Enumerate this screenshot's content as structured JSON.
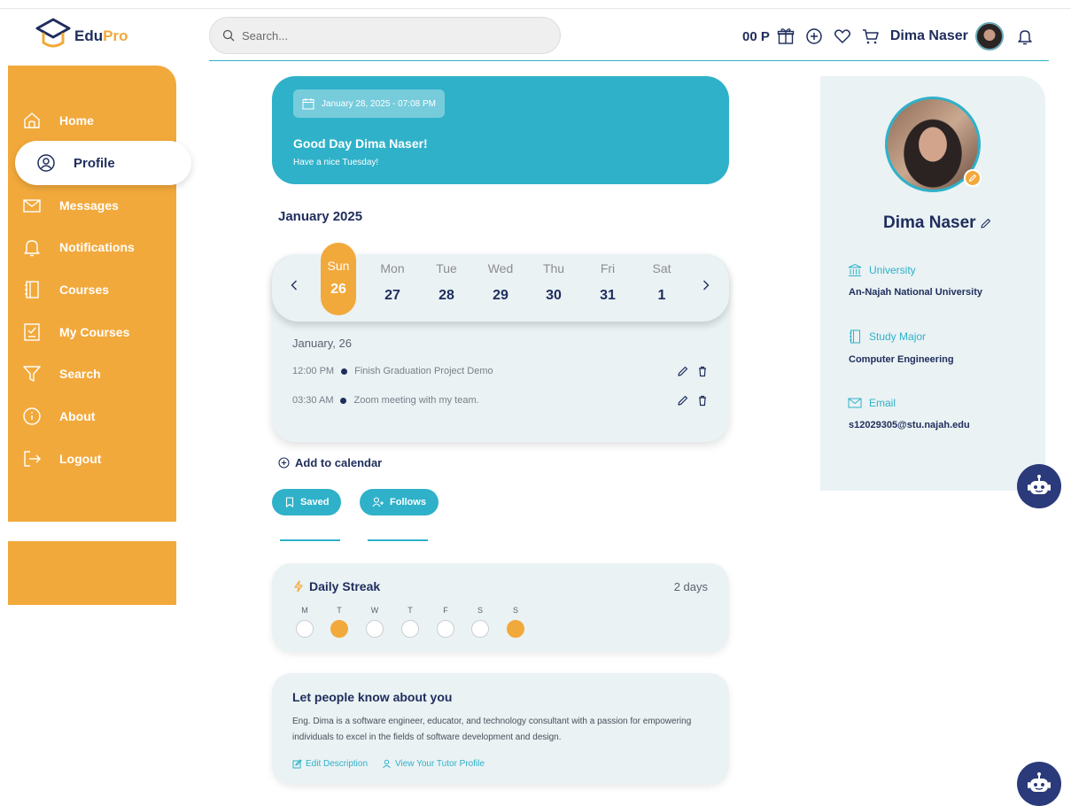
{
  "app": {
    "logo_main": "Edu",
    "logo_accent": "Pro"
  },
  "header": {
    "search_placeholder": "Search...",
    "points": "00 P",
    "user_name": "Dima Naser"
  },
  "sidebar": {
    "items": [
      {
        "label": "Home",
        "icon": "home-icon"
      },
      {
        "label": "Profile",
        "icon": "user-icon",
        "active": true
      },
      {
        "label": "Messages",
        "icon": "mail-icon"
      },
      {
        "label": "Notifications",
        "icon": "bell-icon"
      },
      {
        "label": "Courses",
        "icon": "notebook-icon"
      },
      {
        "label": "My Courses",
        "icon": "checklist-icon"
      },
      {
        "label": "Search",
        "icon": "filter-icon"
      },
      {
        "label": "About",
        "icon": "info-icon"
      },
      {
        "label": "Logout",
        "icon": "logout-icon"
      }
    ]
  },
  "banner": {
    "datetime": "January 28, 2025 - 07:08 PM",
    "greeting": "Good Day Dima Naser!",
    "subtitle": "Have a nice Tuesday!"
  },
  "calendar": {
    "month": "January 2025",
    "days": [
      {
        "name": "Sun",
        "num": "26",
        "selected": true
      },
      {
        "name": "Mon",
        "num": "27"
      },
      {
        "name": "Tue",
        "num": "28"
      },
      {
        "name": "Wed",
        "num": "29"
      },
      {
        "name": "Thu",
        "num": "30"
      },
      {
        "name": "Fri",
        "num": "31"
      },
      {
        "name": "Sat",
        "num": "1"
      }
    ],
    "selected_date_label": "January, 26",
    "events": [
      {
        "time": "12:00 PM",
        "title": "Finish Graduation Project Demo"
      },
      {
        "time": "03:30 AM",
        "title": "Zoom meeting with my team."
      }
    ],
    "add_label": "Add to calendar"
  },
  "tabs": {
    "saved": "Saved",
    "follows": "Follows"
  },
  "streak": {
    "title": "Daily Streak",
    "count": "2 days",
    "week": [
      {
        "letter": "M",
        "done": false
      },
      {
        "letter": "T",
        "done": true
      },
      {
        "letter": "W",
        "done": false
      },
      {
        "letter": "T",
        "done": false
      },
      {
        "letter": "F",
        "done": false
      },
      {
        "letter": "S",
        "done": false
      },
      {
        "letter": "S",
        "done": true
      }
    ]
  },
  "about": {
    "title": "Let people know about you",
    "text": "Eng. Dima is a software engineer, educator, and technology consultant with a passion for empowering individuals to excel in the fields of software development and design.",
    "edit_link": "Edit Description",
    "tutor_link": "View Your Tutor Profile"
  },
  "profile": {
    "name": "Dima Naser",
    "university_label": "University",
    "university": "An-Najah National University",
    "major_label": "Study Major",
    "major": "Computer Engineering",
    "email_label": "Email",
    "email": "s12029305@stu.najah.edu"
  },
  "colors": {
    "accent_orange": "#f2a93b",
    "accent_teal": "#2fb1c9",
    "navy": "#1f2d5c",
    "card_bg": "#eaf2f4"
  }
}
